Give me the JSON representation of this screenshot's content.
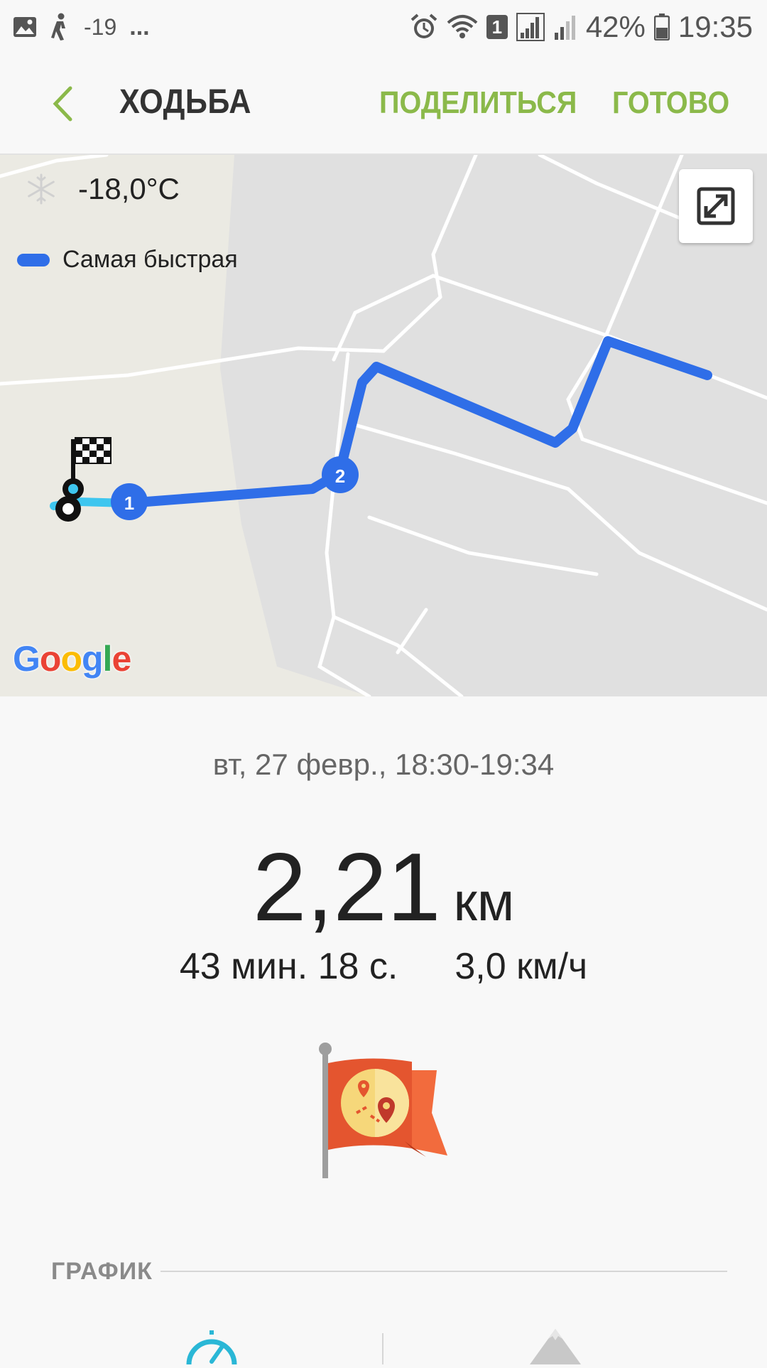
{
  "status_bar": {
    "temperature": "-19",
    "more": "...",
    "sim_slot": "1",
    "battery": "42%",
    "time": "19:35"
  },
  "app_bar": {
    "title": "ХОДЬБА",
    "share_label": "ПОДЕЛИТЬСЯ",
    "done_label": "ГОТОВО"
  },
  "map": {
    "temperature": "-18,0°C",
    "legend_label": "Самая быстрая",
    "route_color": "#2f6ee8",
    "markers": [
      "1",
      "2"
    ],
    "attribution": [
      "G",
      "o",
      "o",
      "g",
      "l",
      "e"
    ]
  },
  "workout": {
    "date_range": "вт, 27 февр., 18:30-19:34",
    "distance_value": "2,21",
    "distance_unit": "км",
    "duration": "43 мин. 18 с.",
    "avg_speed": "3,0 км/ч"
  },
  "chart_section": {
    "title": "ГРАФИК"
  },
  "colors": {
    "accent": "#8bb94a",
    "route": "#2f6ee8",
    "flag": "#f0593a"
  }
}
